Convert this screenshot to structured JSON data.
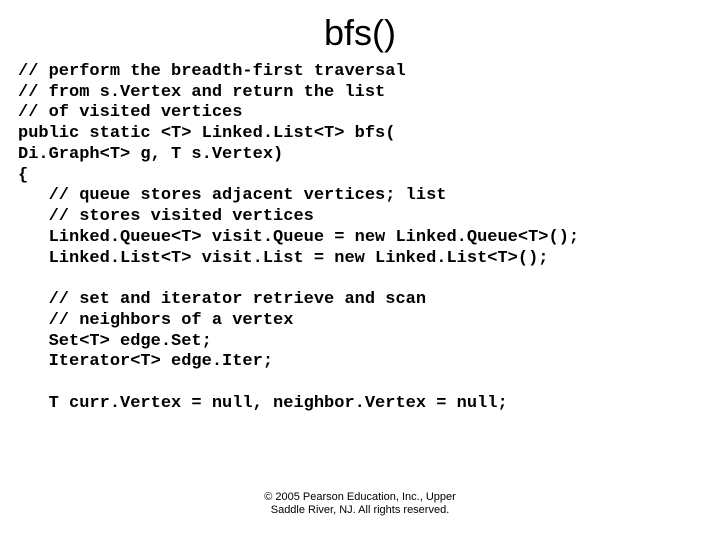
{
  "title": "bfs()",
  "code": "// perform the breadth-first traversal\n// from s.Vertex and return the list\n// of visited vertices\npublic static <T> Linked.List<T> bfs(\nDi.Graph<T> g, T s.Vertex)\n{\n   // queue stores adjacent vertices; list\n   // stores visited vertices\n   Linked.Queue<T> visit.Queue = new Linked.Queue<T>();\n   Linked.List<T> visit.List = new Linked.List<T>();\n\n   // set and iterator retrieve and scan\n   // neighbors of a vertex\n   Set<T> edge.Set;\n   Iterator<T> edge.Iter;\n\n   T curr.Vertex = null, neighbor.Vertex = null;",
  "footer": {
    "line1": "© 2005 Pearson Education, Inc., Upper",
    "line2": "Saddle River, NJ. All rights reserved."
  }
}
